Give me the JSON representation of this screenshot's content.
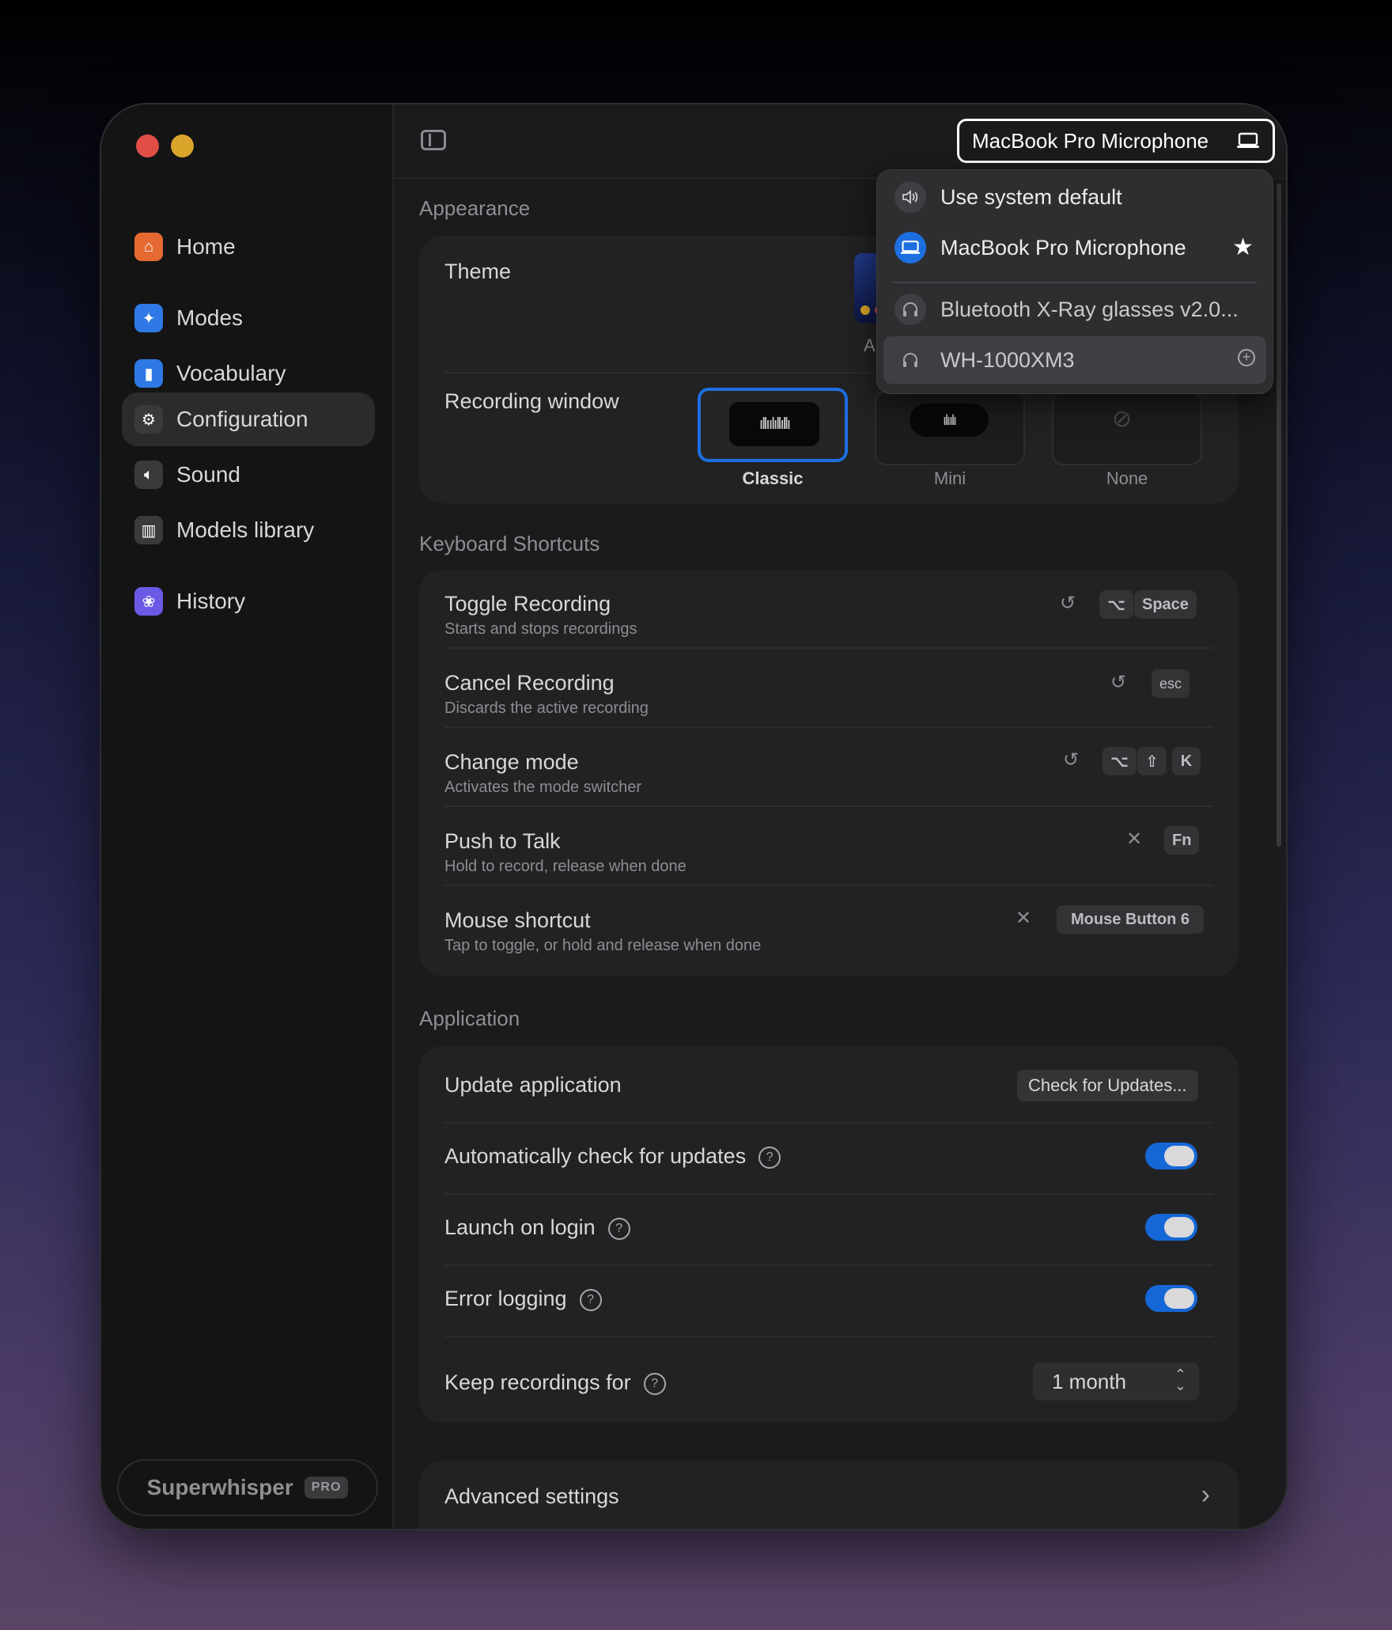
{
  "sidebar": {
    "items": [
      {
        "label": "Home",
        "icon": "house-icon"
      },
      {
        "label": "Modes",
        "icon": "sparkle-icon"
      },
      {
        "label": "Vocabulary",
        "icon": "book-icon"
      },
      {
        "label": "Configuration",
        "icon": "gear-icon"
      },
      {
        "label": "Sound",
        "icon": "speaker-icon"
      },
      {
        "label": "Models library",
        "icon": "library-icon"
      },
      {
        "label": "History",
        "icon": "history-icon"
      }
    ],
    "active": "Configuration",
    "brand": "Superwhisper",
    "brand_badge": "PRO"
  },
  "topbar": {
    "microphone_selected": "MacBook Pro Microphone"
  },
  "mic_menu": {
    "items": [
      {
        "label": "Use system default",
        "icon": "speaker-icon"
      },
      {
        "label": "MacBook Pro Microphone",
        "icon": "laptop-icon",
        "starred": true
      },
      {
        "label": "Bluetooth X-Ray glasses v2.0...",
        "icon": "headphones-icon"
      },
      {
        "label": "WH-1000XM3",
        "icon": "headphones-icon"
      }
    ]
  },
  "appearance": {
    "title": "Appearance",
    "theme_label": "Theme",
    "theme_partial_label": "A",
    "recording_window_label": "Recording window",
    "recording_options": [
      "Classic",
      "Mini",
      "None"
    ],
    "recording_selected": "Classic"
  },
  "shortcuts": {
    "title": "Keyboard Shortcuts",
    "rows": [
      {
        "title": "Toggle Recording",
        "subtitle": "Starts and stops recordings",
        "keys": [
          "⌥",
          "Space"
        ]
      },
      {
        "title": "Cancel Recording",
        "subtitle": "Discards the active recording",
        "keys": [
          "esc"
        ]
      },
      {
        "title": "Change mode",
        "subtitle": "Activates the mode switcher",
        "keys": [
          "⌥",
          "⇧",
          "K"
        ]
      },
      {
        "title": "Push to Talk",
        "subtitle": "Hold to record, release when done",
        "keys": [
          "Fn"
        ]
      },
      {
        "title": "Mouse shortcut",
        "subtitle": "Tap to toggle, or hold and release when done",
        "keys": [
          "Mouse Button 6"
        ]
      }
    ]
  },
  "application": {
    "title": "Application",
    "update_label": "Update application",
    "update_button": "Check for Updates...",
    "auto_check_label": "Automatically check for updates",
    "auto_check_on": true,
    "launch_label": "Launch on login",
    "launch_on": true,
    "error_label": "Error logging",
    "error_on": true,
    "keep_label": "Keep recordings for",
    "keep_value": "1 month"
  },
  "advanced": {
    "label": "Advanced settings"
  },
  "colors": {
    "accent": "#1d6fe0",
    "toggle_on": "#1567d6",
    "close": "#e14e47",
    "minimize": "#d9a52b"
  }
}
